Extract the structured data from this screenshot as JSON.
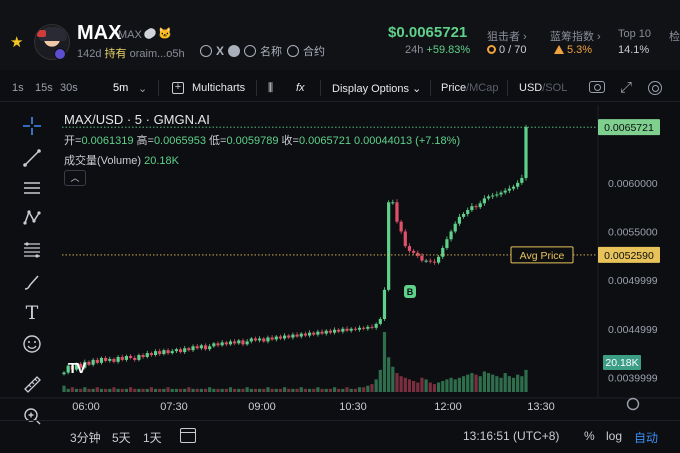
{
  "header": {
    "ticker": "MAX",
    "ticker_sub": "MAX",
    "age": "142d",
    "hold_label": "持有",
    "address": "oraim...o5h",
    "name_label": "名称",
    "contract_label": "合约",
    "price": "$0.0065721",
    "change_period": "24h",
    "change_value": "+59.83%",
    "stats": [
      {
        "label": "狙击者 ›",
        "value": "0 / 70"
      },
      {
        "label": "蓝筹指数 ›",
        "value": "5.3%"
      },
      {
        "label": "Top 10",
        "value": "14.1%"
      },
      {
        "label": "检",
        "value": ""
      }
    ]
  },
  "toolbar": {
    "intervals": [
      "1s",
      "15s",
      "30s",
      "5m"
    ],
    "active_interval": "5m",
    "multicharts": "Multicharts",
    "display_options": "Display Options",
    "price_label": "Price",
    "mcap_label": "MCap",
    "usd_label": "USD",
    "sol_label": "SOL",
    "separator": "/"
  },
  "chart_header": {
    "title": "MAX/USD · 5 · GMGN.AI",
    "open_label": "开=",
    "open": "0.0061319",
    "high_label": "高=",
    "high": "0.0065953",
    "low_label": "低=",
    "low": "0.0059789",
    "close_label": "收=",
    "close": "0.0065721",
    "change": "0.00044013 (+7.18%)",
    "volume_label": "成交量(Volume)",
    "volume": "20.18K"
  },
  "chart_data": {
    "type": "candlestick",
    "title": "MAX/USD · 5 · GMGN.AI",
    "x_ticks": [
      "06:00",
      "07:30",
      "09:00",
      "10:30",
      "12:00",
      "13:30"
    ],
    "y_ticks": [
      0.0039999,
      0.0044999,
      0.0049999,
      0.0055,
      0.006
    ],
    "y_tick_labels": [
      "0.0039999",
      "0.0044999",
      "0.0049999",
      "0.0055000",
      "0.0060000"
    ],
    "ylim": [
      0.00385,
      0.0068
    ],
    "last_price": 0.0065721,
    "last_price_label": "0.0065721",
    "avg_price": 0.005259,
    "avg_price_label": "0.0052590",
    "avg_label": "Avg Price",
    "volume_label": "20.18K",
    "buy_marker": "B",
    "closes": [
      0.00405,
      0.00412,
      0.00408,
      0.00414,
      0.0041,
      0.00416,
      0.00413,
      0.00418,
      0.00415,
      0.0042,
      0.00417,
      0.00419,
      0.00416,
      0.00421,
      0.00418,
      0.00422,
      0.0042,
      0.00418,
      0.00423,
      0.00421,
      0.00425,
      0.00423,
      0.00427,
      0.00424,
      0.00428,
      0.00425,
      0.00427,
      0.00429,
      0.00426,
      0.0043,
      0.00428,
      0.00432,
      0.0043,
      0.00433,
      0.00429,
      0.00432,
      0.00435,
      0.00433,
      0.00436,
      0.00434,
      0.00437,
      0.00435,
      0.00438,
      0.00434,
      0.00437,
      0.0044,
      0.00438,
      0.0044,
      0.00437,
      0.00441,
      0.00439,
      0.00442,
      0.0044,
      0.00443,
      0.00441,
      0.00444,
      0.00442,
      0.00445,
      0.00443,
      0.00446,
      0.00444,
      0.00447,
      0.00445,
      0.00448,
      0.00446,
      0.00449,
      0.00447,
      0.0045,
      0.00448,
      0.0045,
      0.00449,
      0.00451,
      0.0045,
      0.00452,
      0.00451,
      0.00455,
      0.0046,
      0.0049,
      0.0058,
      0.0058,
      0.0056,
      0.0055,
      0.00535,
      0.0053,
      0.00528,
      0.00525,
      0.0052,
      0.0052,
      0.00519,
      0.00518,
      0.00524,
      0.00533,
      0.00542,
      0.0055,
      0.00558,
      0.00565,
      0.00568,
      0.00572,
      0.00576,
      0.00575,
      0.00579,
      0.00584,
      0.00586,
      0.00587,
      0.00588,
      0.0059,
      0.00592,
      0.00594,
      0.00596,
      0.006,
      0.00605,
      0.0065721
    ],
    "volumes": [
      4,
      2,
      3,
      2,
      2,
      3,
      2,
      2,
      3,
      2,
      2,
      2,
      3,
      2,
      2,
      2,
      3,
      2,
      2,
      2,
      2,
      3,
      2,
      2,
      2,
      3,
      2,
      2,
      2,
      2,
      3,
      2,
      2,
      2,
      2,
      3,
      2,
      2,
      2,
      2,
      3,
      2,
      2,
      2,
      3,
      2,
      2,
      2,
      2,
      3,
      2,
      2,
      2,
      3,
      2,
      2,
      2,
      3,
      2,
      2,
      2,
      3,
      2,
      2,
      2,
      3,
      2,
      2,
      3,
      2,
      2,
      3,
      3,
      4,
      5,
      8,
      14,
      38,
      22,
      16,
      12,
      10,
      9,
      8,
      7,
      6,
      9,
      8,
      6,
      5,
      6,
      7,
      8,
      9,
      8,
      9,
      10,
      11,
      12,
      11,
      10,
      13,
      12,
      11,
      10,
      9,
      12,
      10,
      9,
      11,
      10,
      14
    ]
  },
  "bottom": {
    "ranges": [
      "3分钟",
      "5天",
      "1天"
    ],
    "time": "13:16:51 (UTC+8)",
    "percent": "%",
    "log": "log",
    "auto": "自动"
  },
  "colors": {
    "up": "#5fd18a",
    "down": "#e0506a",
    "avg": "#e8c35a",
    "accent": "#3b8df0"
  }
}
